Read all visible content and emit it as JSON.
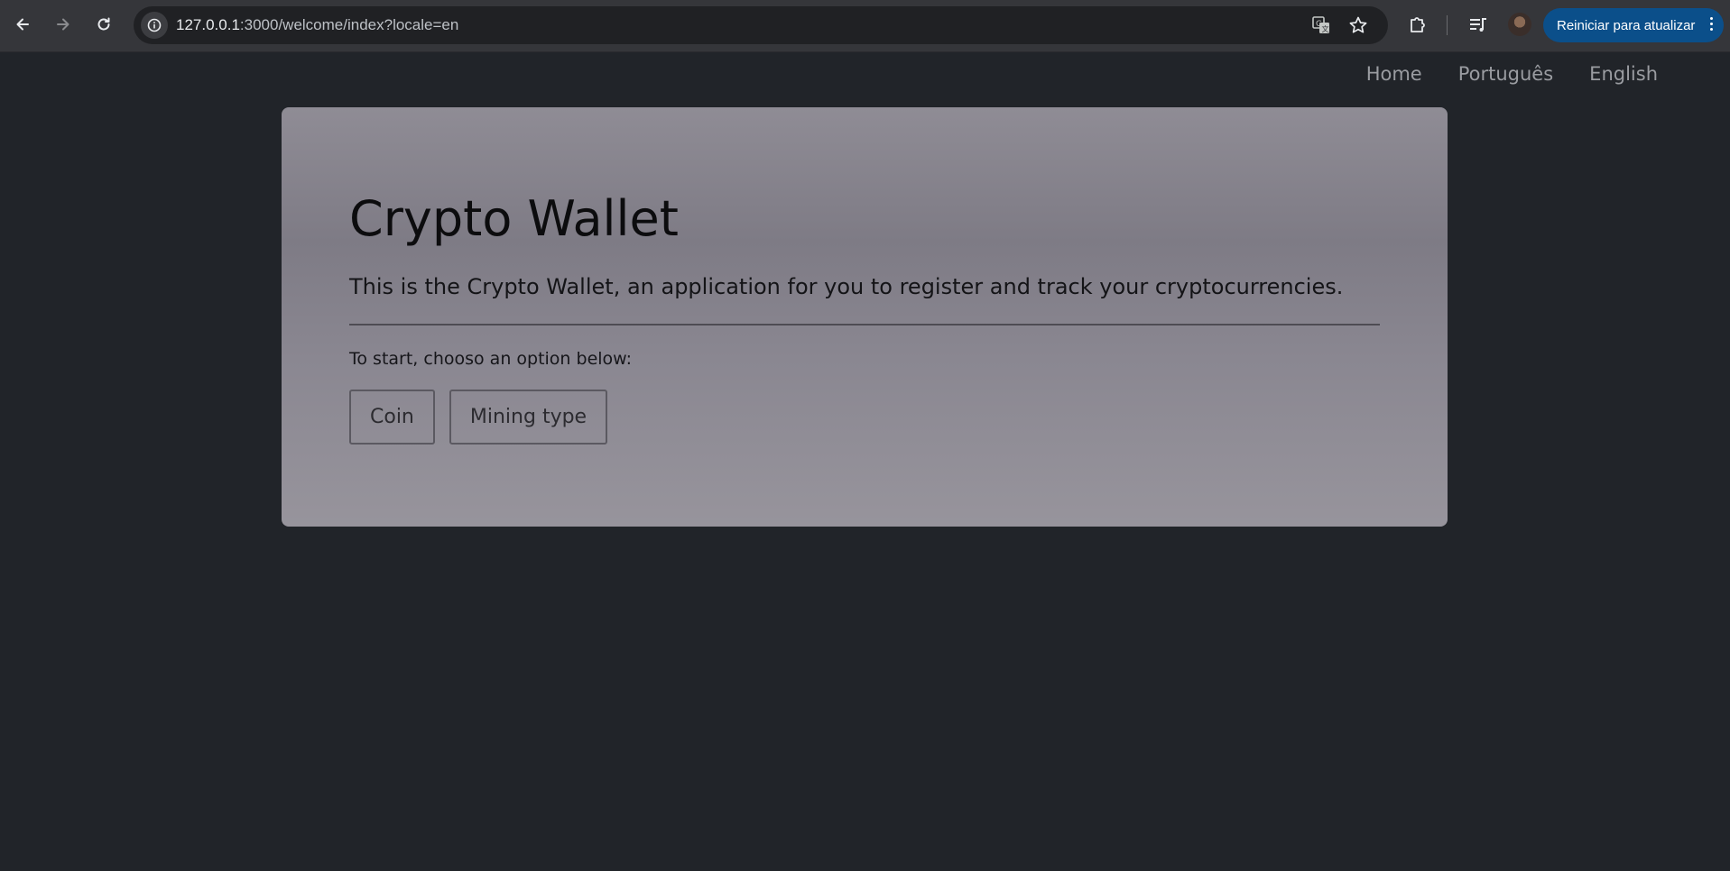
{
  "browser": {
    "url_host": "127.0.0.1",
    "url_path": ":3000/welcome/index?locale=en",
    "update_button_label": "Reiniciar para atualizar",
    "icons": [
      "back-icon",
      "forward-icon",
      "reload-icon",
      "site-info-icon",
      "translate-icon",
      "bookmark-star-icon",
      "extensions-icon",
      "media-control-icon",
      "profile-avatar",
      "kebab-menu-icon"
    ],
    "accent_color": "#0b4f8a"
  },
  "nav": {
    "home": "Home",
    "portuguese": "Português",
    "english": "English"
  },
  "jumbotron": {
    "title": "Crypto Wallet",
    "lead": "This is the Crypto Wallet, an application for you to register and track your cryptocurrencies.",
    "prompt": "To start, chooso an option below:",
    "buttons": {
      "coin": "Coin",
      "mining_type": "Mining type"
    }
  },
  "colors": {
    "page_background": "#212429",
    "jumbotron_background": "#8a8791",
    "nav_link": "#9a9ca1"
  }
}
